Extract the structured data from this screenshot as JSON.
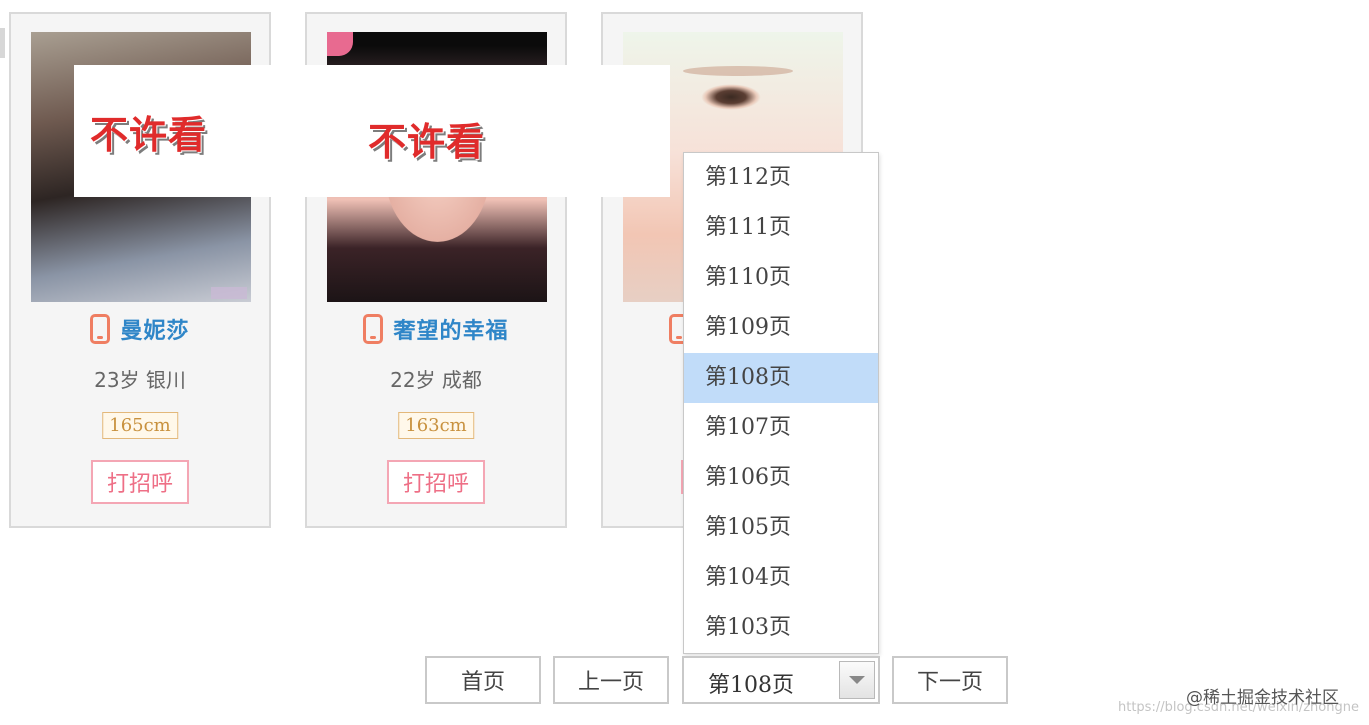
{
  "cards": [
    {
      "name": "曼妮莎",
      "info": "23岁 银川",
      "height": "165cm",
      "greet": "打招呼"
    },
    {
      "name": "奢望的幸福",
      "info": "22岁 成都",
      "height": "163cm",
      "greet": "打招呼"
    },
    {
      "name": "",
      "info": "",
      "height": "",
      "greet": ""
    }
  ],
  "censor": [
    "不许看",
    "不许看"
  ],
  "dropdown": {
    "options": [
      "第112页",
      "第111页",
      "第110页",
      "第109页",
      "第108页",
      "第107页",
      "第106页",
      "第105页",
      "第104页",
      "第103页"
    ],
    "selected": "第108页"
  },
  "pagination": {
    "first": "首页",
    "prev": "上一页",
    "current": "第108页",
    "next": "下一页"
  },
  "watermark": {
    "community": "@稀土掘金技术社区",
    "url": "https://blog.csdn.net/weixin/zhongne"
  },
  "colors": {
    "name": "#2f86c8",
    "accent_phone": "#ef7e62",
    "greet": "#ee6f86",
    "height_tag": "#c8913e",
    "censor": "#e02b2b",
    "selected_option": "#c1dcf9"
  }
}
